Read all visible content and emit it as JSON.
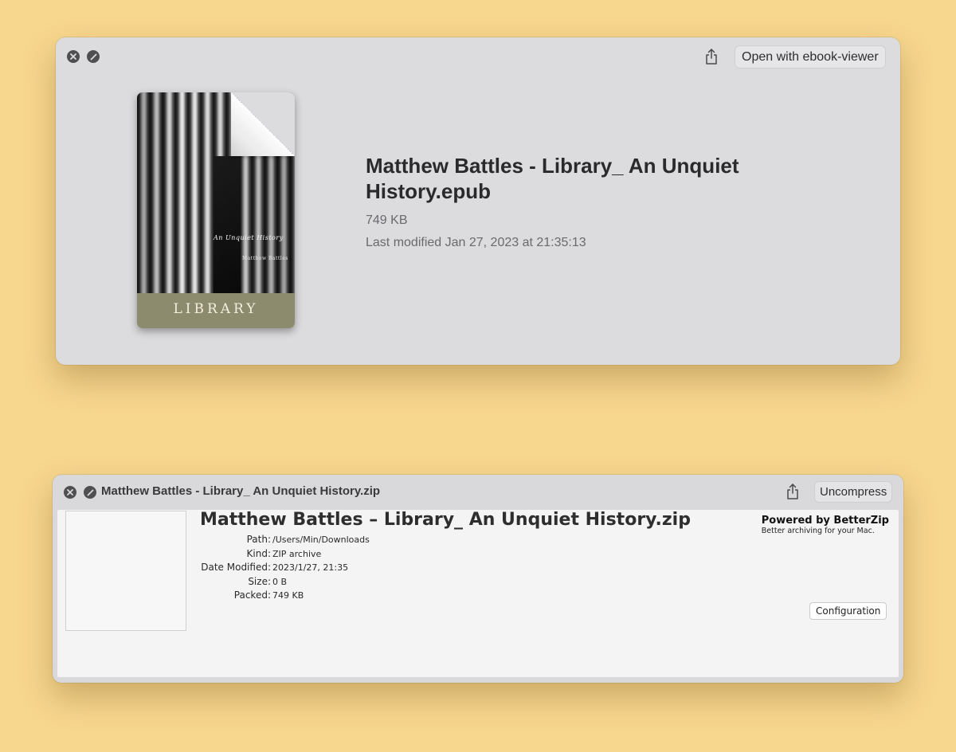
{
  "quicklook_window": {
    "open_with_label": "Open with ebook-viewer",
    "file_title": "Matthew Battles - Library_ An Unquiet History.epub",
    "file_size": "749 KB",
    "last_modified": "Last modified Jan 27, 2023 at 21:35:13",
    "cover": {
      "subtitle": "An Unquiet History",
      "author": "Matthew Battles",
      "title": "LIBRARY",
      "band_color": "#8d8b6e"
    }
  },
  "betterzip_window": {
    "window_title": "Matthew Battles - Library_ An Unquiet History.zip",
    "uncompress_label": "Uncompress",
    "archive_title": "Matthew Battles – Library_ An Unquiet History.zip",
    "info": {
      "path_label": "Path:",
      "path_value": "/Users/Min/Downloads",
      "kind_label": "Kind:",
      "kind_value": "ZIP archive",
      "date_label": "Date Modified:",
      "date_value": "2023/1/27, 21:35",
      "size_label": "Size:",
      "size_value": "0 B",
      "packed_label": "Packed:",
      "packed_value": "749 KB"
    },
    "powered_by": "Powered by BetterZip",
    "tagline": "Better archiving for your Mac.",
    "configuration_label": "Configuration"
  },
  "icons": [
    "close-icon",
    "full-screen-icon",
    "share-icon"
  ],
  "colors": {
    "background": "#f7d68e",
    "window": "#dcdcde",
    "panel": "#f4f4f5"
  }
}
